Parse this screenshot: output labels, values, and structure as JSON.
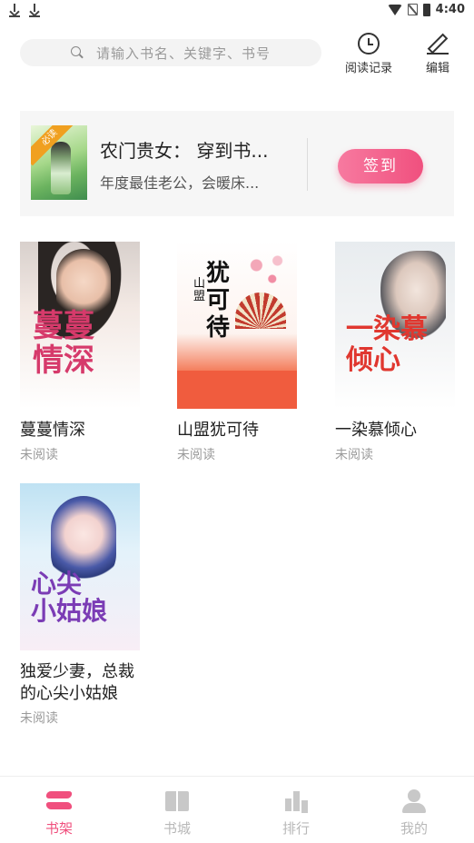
{
  "status_bar": {
    "time": "4:40"
  },
  "search": {
    "placeholder": "请输入书名、关键字、书号"
  },
  "header_actions": {
    "history_label": "阅读记录",
    "edit_label": "编辑"
  },
  "banner": {
    "ribbon": "必读",
    "title": "农门贵女： 穿到书...",
    "subtitle": "年度最佳老公，会暖床...",
    "checkin_label": "签到"
  },
  "books": [
    {
      "title": "蔓蔓情深",
      "status": "未阅读"
    },
    {
      "title": "山盟犹可待",
      "status": "未阅读"
    },
    {
      "title": "一染慕倾心",
      "status": "未阅读"
    },
    {
      "title": "独爱少妻，总裁的心尖小姑娘",
      "status": "未阅读"
    }
  ],
  "tabs": [
    {
      "label": "书架",
      "icon": "bookshelf-icon",
      "active": true
    },
    {
      "label": "书城",
      "icon": "bookstore-icon",
      "active": false
    },
    {
      "label": "排行",
      "icon": "ranking-icon",
      "active": false
    },
    {
      "label": "我的",
      "icon": "profile-icon",
      "active": false
    }
  ],
  "colors": {
    "accent": "#f0507e",
    "inactive": "#b8b8b8"
  }
}
